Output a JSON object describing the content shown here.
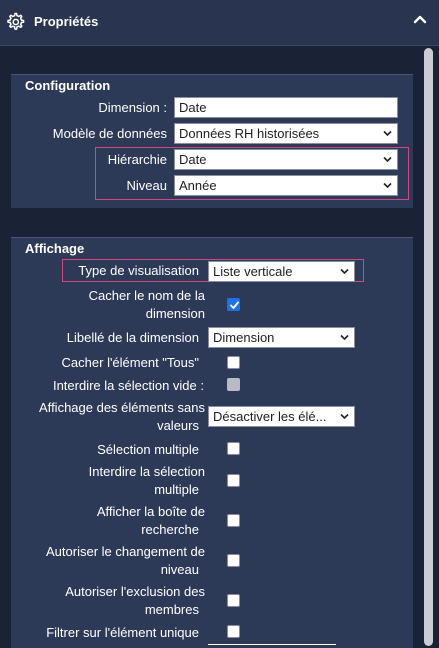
{
  "header": {
    "title": "Propriétés"
  },
  "configuration": {
    "title": "Configuration",
    "dimension": {
      "label": "Dimension :",
      "value": "Date"
    },
    "modele": {
      "label": "Modèle de données",
      "value": "Données RH historisées"
    },
    "hierarchie": {
      "label": "Hiérarchie",
      "value": "Date"
    },
    "niveau": {
      "label": "Niveau",
      "value": "Année"
    }
  },
  "affichage": {
    "title": "Affichage",
    "type_visu": {
      "label": "Type de visualisation",
      "value": "Liste verticale"
    },
    "cacher_nom": {
      "label_line1": "Cacher le nom de la",
      "label_line2": "dimension",
      "checked": true
    },
    "libelle": {
      "label": "Libellé de la dimension",
      "value": "Dimension"
    },
    "cacher_tous": {
      "label": "Cacher l'élément \"Tous\"",
      "checked": false
    },
    "interdire_vide": {
      "label": "Interdire la sélection vide :",
      "checked": false,
      "disabled": true
    },
    "elements_sans_valeurs": {
      "label_line1": "Affichage des éléments sans",
      "label_line2": "valeurs",
      "value": "Désactiver les élé..."
    },
    "selection_multiple": {
      "label": "Sélection multiple",
      "checked": false
    },
    "interdire_multiple": {
      "label_line1": "Interdire la sélection",
      "label_line2": "multiple",
      "checked": false
    },
    "boite_recherche": {
      "label_line1": "Afficher la boîte de",
      "label_line2": "recherche",
      "checked": false
    },
    "changement_niveau": {
      "label_line1": "Autoriser le changement de",
      "label_line2": "niveau",
      "checked": false
    },
    "exclusion_membres": {
      "label_line1": "Autoriser l'exclusion des",
      "label_line2": "membres",
      "checked": false
    },
    "filtrer_unique": {
      "label": "Filtrer sur l'élément unique",
      "checked": false
    }
  }
}
